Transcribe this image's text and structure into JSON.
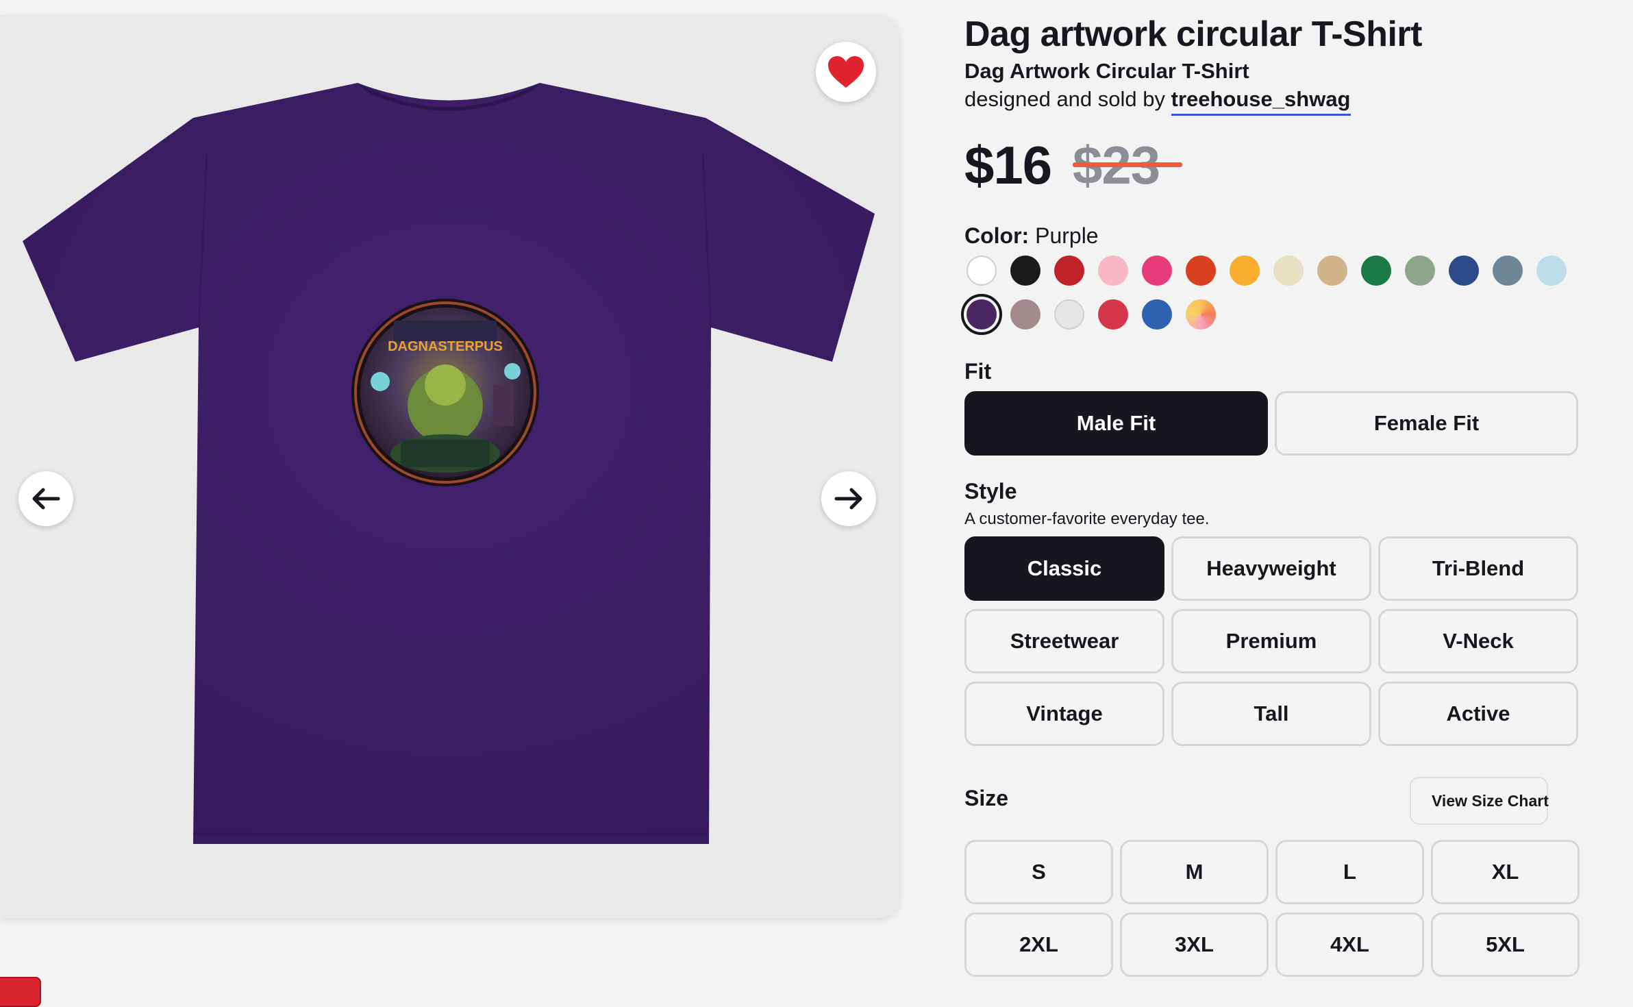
{
  "product": {
    "title": "Dag artwork circular T-Shirt",
    "subtitle": "Dag Artwork Circular T-Shirt",
    "designer_prefix": "designed and sold by ",
    "designer_name": "treehouse_shwag",
    "shirt_graphic_text": "DAGNASTERPUS"
  },
  "price": {
    "current": "$16",
    "original": "$23",
    "accent": "#ee5a3a"
  },
  "color": {
    "label": "Color:",
    "selected": "Purple",
    "swatches": [
      {
        "name": "white",
        "hex": "#ffffff"
      },
      {
        "name": "black",
        "hex": "#1a1a1a"
      },
      {
        "name": "red",
        "hex": "#c0222a"
      },
      {
        "name": "light-pink",
        "hex": "#f7b7c6"
      },
      {
        "name": "hot-pink",
        "hex": "#e83b7a"
      },
      {
        "name": "orange",
        "hex": "#d9401e"
      },
      {
        "name": "gold",
        "hex": "#f8ae2c"
      },
      {
        "name": "cream",
        "hex": "#e8e0c5"
      },
      {
        "name": "tan",
        "hex": "#d2b48c"
      },
      {
        "name": "kelly-green",
        "hex": "#1a7a45"
      },
      {
        "name": "sage",
        "hex": "#8ea68c"
      },
      {
        "name": "navy-blue",
        "hex": "#2d4a8a"
      },
      {
        "name": "slate",
        "hex": "#6d8799"
      },
      {
        "name": "light-blue",
        "hex": "#bcdde9"
      },
      {
        "name": "purple",
        "hex": "#4b2660"
      },
      {
        "name": "mauve",
        "hex": "#a48a8e"
      },
      {
        "name": "heather-white",
        "hex": "#e5e5e5"
      },
      {
        "name": "crimson",
        "hex": "#d63649"
      },
      {
        "name": "royal-blue",
        "hex": "#2f63b0"
      },
      {
        "name": "tie-dye",
        "hex": "#f9c356"
      }
    ]
  },
  "fit": {
    "label": "Fit",
    "options": [
      "Male Fit",
      "Female Fit"
    ],
    "active": "Male Fit"
  },
  "style": {
    "label": "Style",
    "description": "A customer-favorite everyday tee.",
    "options": [
      "Classic",
      "Heavyweight",
      "Tri-Blend",
      "Streetwear",
      "Premium",
      "V-Neck",
      "Vintage",
      "Tall",
      "Active"
    ],
    "active": "Classic"
  },
  "size": {
    "label": "Size",
    "chart_button": "View Size Chart",
    "options": [
      "S",
      "M",
      "L",
      "XL",
      "2XL",
      "3XL",
      "4XL",
      "5XL"
    ]
  },
  "icons": {
    "favorite": "heart-icon",
    "prev": "arrow-left-icon",
    "next": "arrow-right-icon",
    "size_chart": "ruler-icon"
  },
  "colors": {
    "shirt": "#3a1d62",
    "heart": "#e0242f",
    "active_button": "#17171f",
    "link_underline": "#3c4fd8"
  }
}
